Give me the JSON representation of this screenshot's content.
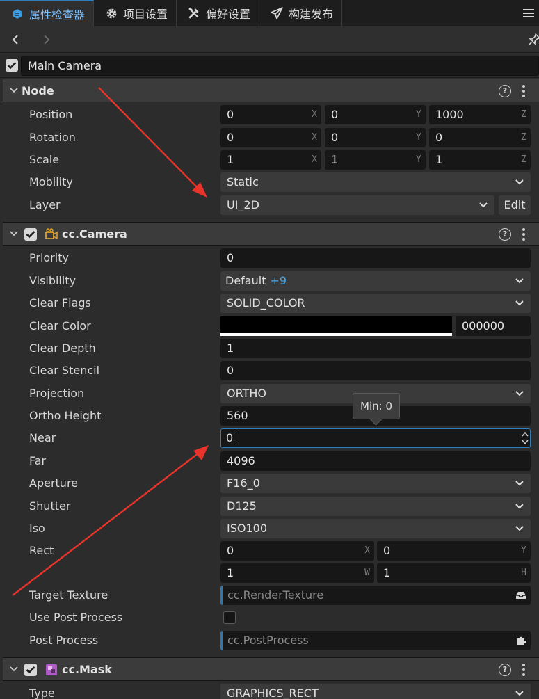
{
  "tabs": [
    {
      "label": "属性检查器",
      "icon": "inspector-icon",
      "active": true
    },
    {
      "label": "项目设置",
      "icon": "gear-icon"
    },
    {
      "label": "偏好设置",
      "icon": "tools-icon"
    },
    {
      "label": "构建发布",
      "icon": "send-icon"
    }
  ],
  "node_name": "Main Camera",
  "node_section": {
    "title": "Node",
    "position": {
      "label": "Position",
      "x": "0",
      "y": "0",
      "z": "1000"
    },
    "rotation": {
      "label": "Rotation",
      "x": "0",
      "y": "0",
      "z": "0"
    },
    "scale": {
      "label": "Scale",
      "x": "1",
      "y": "1",
      "z": "1"
    },
    "mobility": {
      "label": "Mobility",
      "value": "Static"
    },
    "layer": {
      "label": "Layer",
      "value": "UI_2D",
      "edit": "Edit"
    }
  },
  "axes": {
    "x": "X",
    "y": "Y",
    "z": "Z",
    "w": "W",
    "h": "H"
  },
  "camera_section": {
    "title": "cc.Camera",
    "priority": {
      "label": "Priority",
      "value": "0"
    },
    "visibility": {
      "label": "Visibility",
      "value": "Default",
      "extra": "+9"
    },
    "clear_flags": {
      "label": "Clear Flags",
      "value": "SOLID_COLOR"
    },
    "clear_color": {
      "label": "Clear Color",
      "hex": "000000",
      "color": "#000000"
    },
    "clear_depth": {
      "label": "Clear Depth",
      "value": "1"
    },
    "clear_stencil": {
      "label": "Clear Stencil",
      "value": "0"
    },
    "projection": {
      "label": "Projection",
      "value": "ORTHO"
    },
    "ortho_height": {
      "label": "Ortho Height",
      "value": "560"
    },
    "near": {
      "label": "Near",
      "value": "0"
    },
    "far": {
      "label": "Far",
      "value": "4096"
    },
    "aperture": {
      "label": "Aperture",
      "value": "F16_0"
    },
    "shutter": {
      "label": "Shutter",
      "value": "D125"
    },
    "iso": {
      "label": "Iso",
      "value": "ISO100"
    },
    "rect": {
      "label": "Rect",
      "x": "0",
      "y": "0",
      "w": "1",
      "h": "1"
    },
    "target_texture": {
      "label": "Target Texture",
      "placeholder": "cc.RenderTexture"
    },
    "use_post_process": {
      "label": "Use Post Process",
      "checked": false
    },
    "post_process": {
      "label": "Post Process",
      "placeholder": "cc.PostProcess"
    }
  },
  "tooltip": "Min: 0",
  "mask_section": {
    "title": "cc.Mask",
    "type": {
      "label": "Type",
      "value": "GRAPHICS_RECT"
    }
  },
  "colors": {
    "accent": "#2d7fbf",
    "arrow": "#e8342a"
  }
}
